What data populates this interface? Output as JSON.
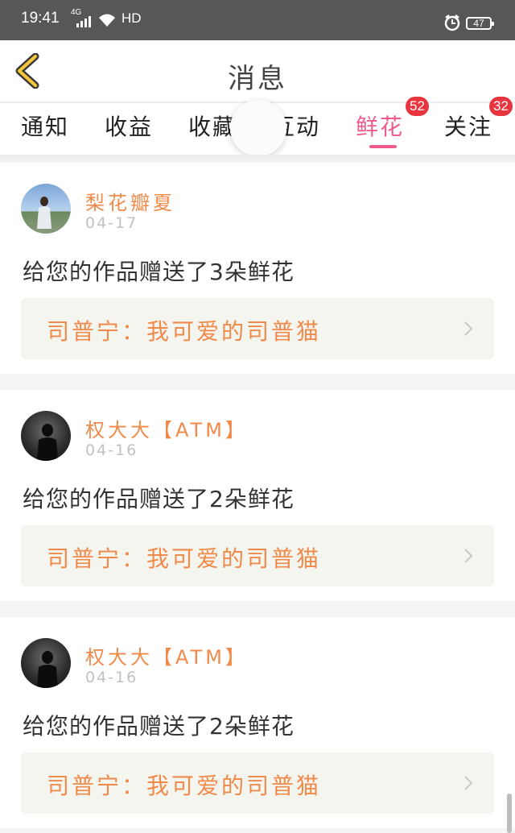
{
  "status_bar": {
    "time": "19:41",
    "network": "4G",
    "hd": "HD",
    "battery": "47"
  },
  "nav": {
    "title": "消息"
  },
  "tabs": [
    {
      "label": "通知"
    },
    {
      "label": "收益"
    },
    {
      "label": "收藏"
    },
    {
      "label": "互动"
    },
    {
      "label": "鲜花",
      "active": true,
      "badge": "52"
    },
    {
      "label": "关注",
      "badge": "32"
    }
  ],
  "colors": {
    "accent_pink": "#ef5a8d",
    "name_orange": "#f08a4a",
    "badge_red": "#e8343f"
  },
  "messages": [
    {
      "user": "梨花瓣夏",
      "date": "04-17",
      "text": "给您的作品赠送了3朵鲜花",
      "work": "司普宁：我可爱的司普猫"
    },
    {
      "user": "权大大【ATM】",
      "date": "04-16",
      "text": "给您的作品赠送了2朵鲜花",
      "work": "司普宁：我可爱的司普猫"
    },
    {
      "user": "权大大【ATM】",
      "date": "04-16",
      "text": "给您的作品赠送了2朵鲜花",
      "work": "司普宁：我可爱的司普猫"
    }
  ]
}
